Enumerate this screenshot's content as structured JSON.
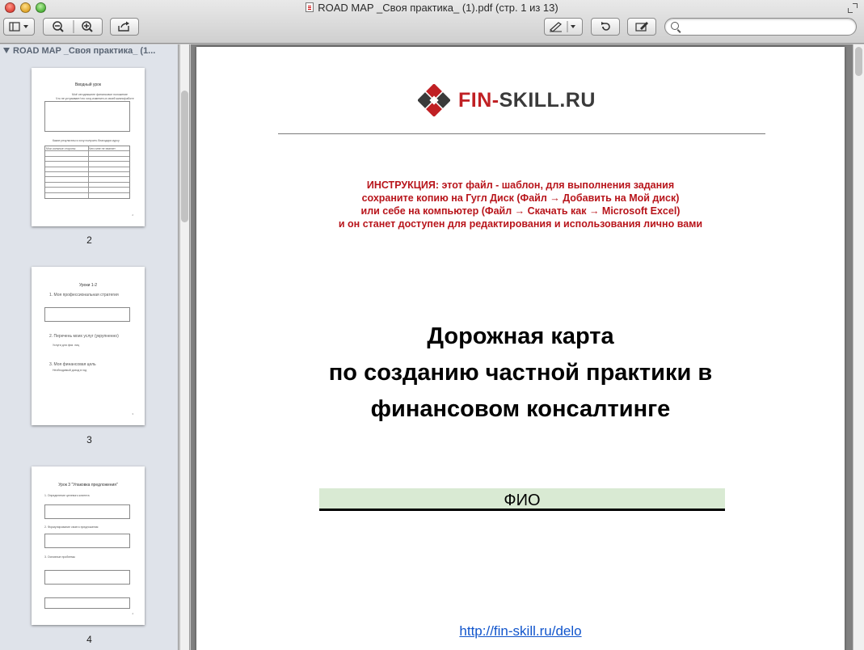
{
  "window": {
    "title": "ROAD MAP _Своя практика_ (1).pdf (стр. 1 из 13)"
  },
  "toolbar": {
    "sidebar_toggle": "sidebar-view-icon",
    "zoom_out": "zoom-out-icon",
    "zoom_in": "zoom-in-icon",
    "share": "share-icon",
    "annotate": "pen-icon",
    "rotate": "rotate-icon",
    "edit": "edit-icon",
    "search_placeholder": ""
  },
  "sidebar": {
    "header": "ROAD MAP _Своя практика_ (1...",
    "thumbnails": [
      {
        "page_label": "2",
        "heading": "Вводный урок",
        "lines": [
          "Моё сегодняшнее финансовое положение",
          "Что не устраивает/что хочу изменить в своей жизни/работе"
        ],
        "midtext": "Какие результаты я хочу получить благодаря курсу",
        "table_head": [
          "Мои сильные стороны",
          "Чего мне не хватает"
        ]
      },
      {
        "page_label": "3",
        "heading": "Уроки 1-2",
        "items": [
          "1. Моя профессиональная стратегия",
          "2. Перечень моих услуг (укрупненно)",
          "3. Моя финансовая цель"
        ],
        "subs": [
          "Услуги для физ. лиц",
          "Необходимый доход в год"
        ]
      },
      {
        "page_label": "4",
        "heading": "Урок 3 \"Упаковка предложения\"",
        "items": [
          "1. Определение целевого клиента",
          "2. Формулирование своего предложения",
          "3. Основные проблемы"
        ]
      }
    ]
  },
  "document": {
    "logo": {
      "prefix": "FIN-",
      "suffix": "SKILL.RU"
    },
    "instructions": [
      "ИНСТРУКЦИЯ: этот файл - шаблон, для выполнения задания",
      "сохраните копию на Гугл Диск (Файл → Добавить на Мой диск)",
      "или себе на компьютер (Файл → Скачать как → Microsoft Excel)",
      "и он станет доступен для редактирования и использования лично вами"
    ],
    "title_lines": [
      "Дорожная карта",
      "по созданию частной практики в",
      "финансовом консалтинге"
    ],
    "fio_label": "ФИО",
    "link": "http://fin-skill.ru/delo"
  },
  "colors": {
    "instruction_red": "#b8151b",
    "fio_fill": "#d9ead3",
    "link_blue": "#1155cc",
    "logo_red": "#c02024"
  }
}
